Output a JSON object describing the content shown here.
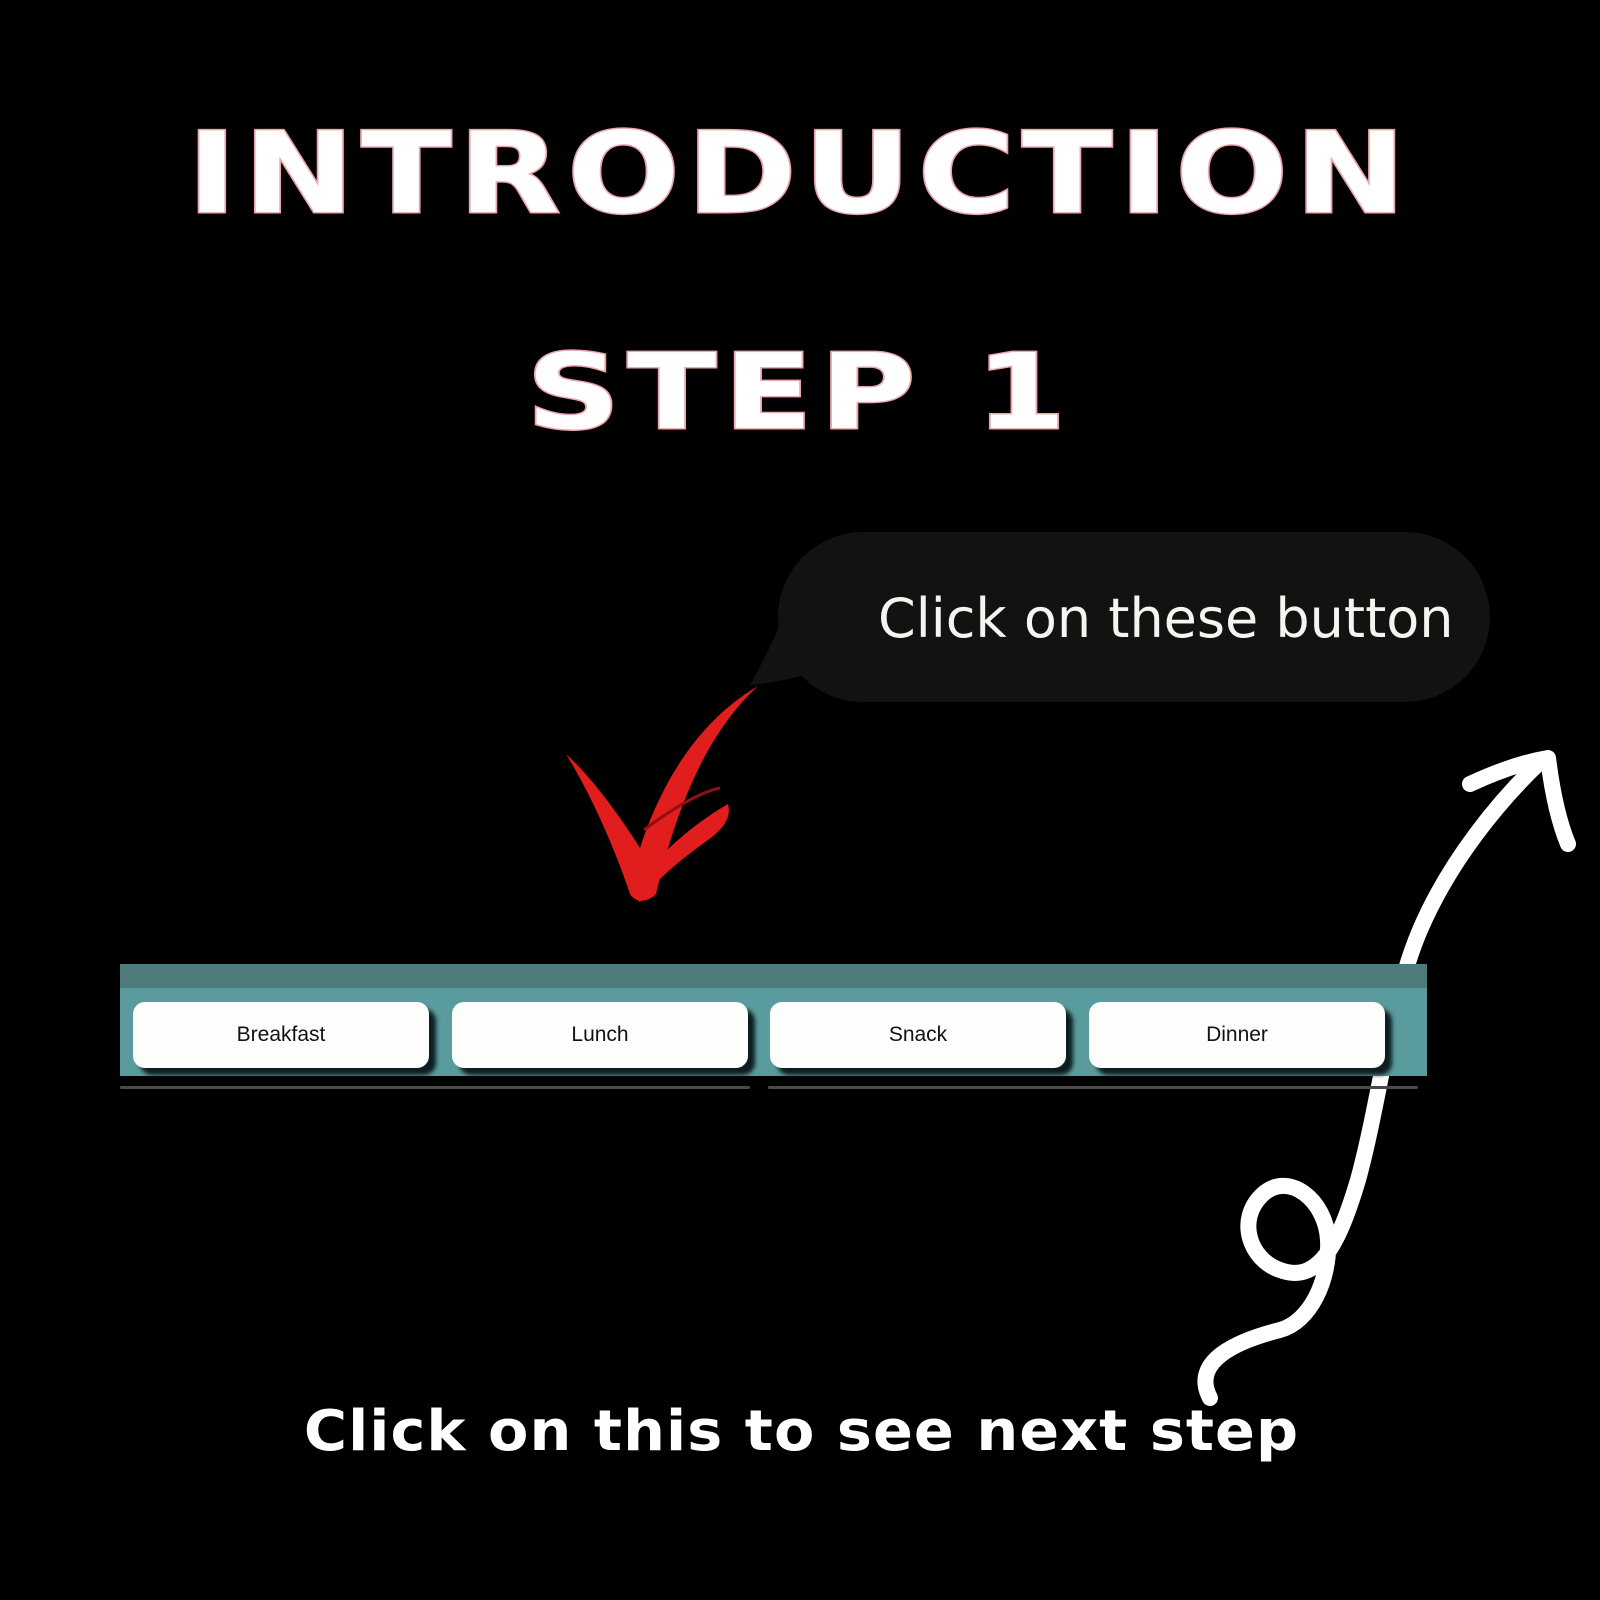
{
  "header": {
    "title": "INTRODUCTION",
    "step": "STEP 1"
  },
  "callout": {
    "text": "Click on these button"
  },
  "menu": {
    "buttons": [
      {
        "label": "Breakfast"
      },
      {
        "label": "Lunch"
      },
      {
        "label": "Snack"
      },
      {
        "label": "Dinner"
      }
    ]
  },
  "footer": {
    "next_step_text": "Click on this to see next step"
  },
  "icons": {
    "red_arrow": "down-arrow-icon",
    "white_arrow": "curly-up-arrow-icon"
  },
  "colors": {
    "background": "#000000",
    "title_outline": "#e8a0a4",
    "bubble": "#121210",
    "menu_bar": "#5a9c9e",
    "menu_bar_top": "#4f7b7d",
    "button": "#fdfdfb",
    "red_arrow": "#e11d1d",
    "white_arrow": "#ffffff"
  }
}
